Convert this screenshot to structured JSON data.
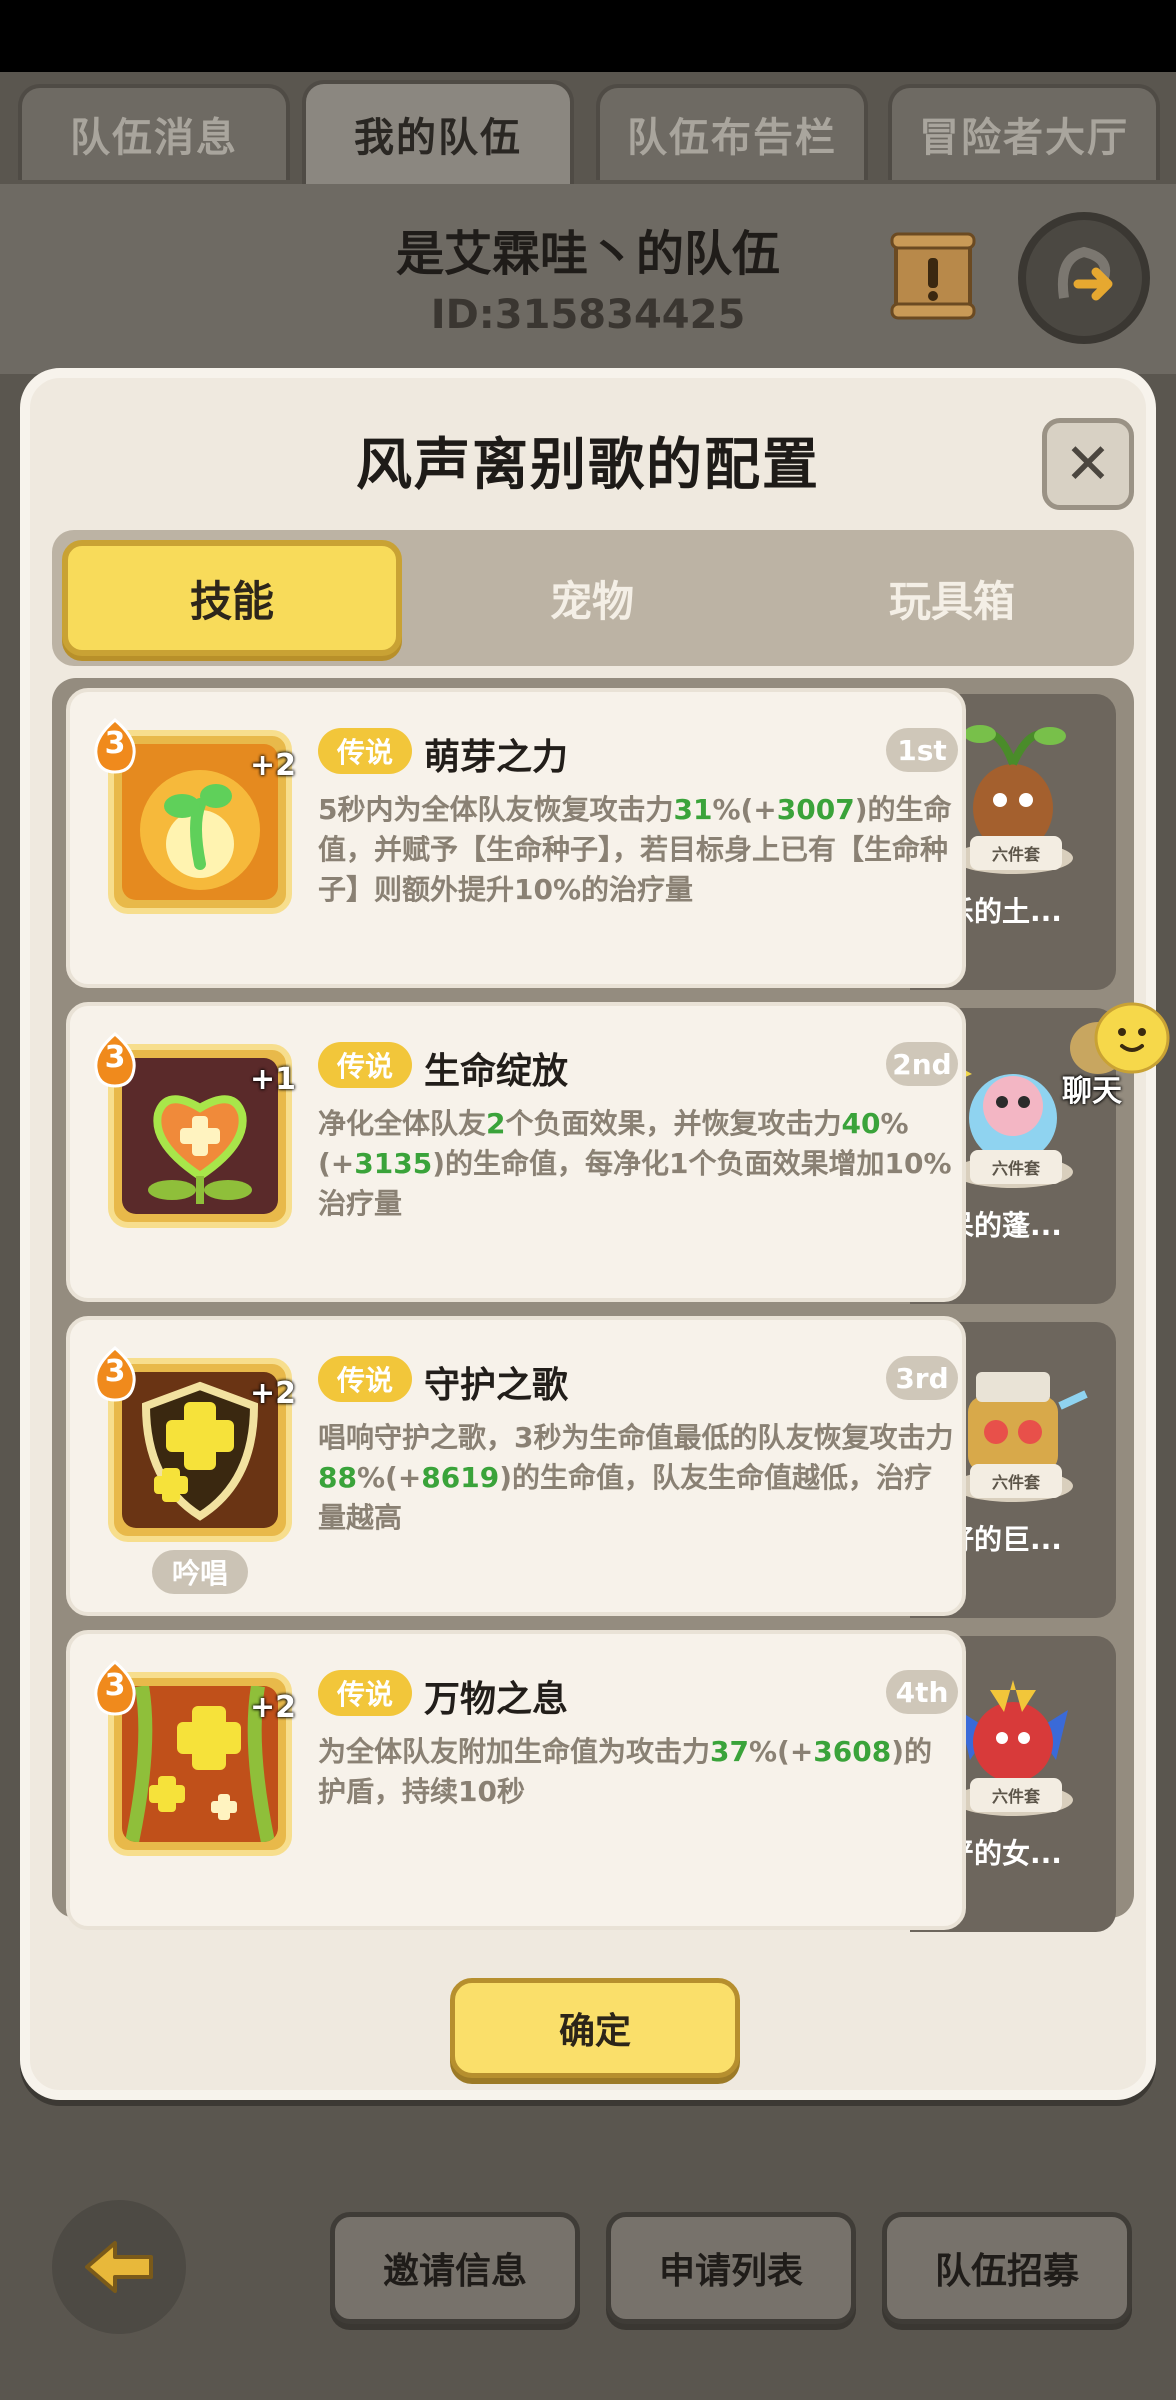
{
  "top_tabs": [
    {
      "label": "队伍消息"
    },
    {
      "label": "我的队伍"
    },
    {
      "label": "队伍布告栏"
    },
    {
      "label": "冒险者大厅"
    }
  ],
  "header": {
    "team_name": "是艾霖哇丶的队伍",
    "team_id": "ID:315834425"
  },
  "modal": {
    "title": "风声离别歌的配置",
    "close_symbol": "✕",
    "tabs": [
      {
        "label": "技能"
      },
      {
        "label": "宠物"
      },
      {
        "label": "玩具箱"
      }
    ],
    "skills": [
      {
        "level": "3",
        "plus": "+2",
        "rarity": "传说",
        "name": "萌芽之力",
        "rank": "1st",
        "desc": [
          "5秒内为全体队友恢复攻击力",
          "31",
          "%(+",
          "3007",
          ")的生命值，并赋予【生命种子】，若目标身上已有【生命种子】则额外提升10%的治疗量"
        ],
        "icon": "sprout-icon"
      },
      {
        "level": "3",
        "plus": "+1",
        "rarity": "传说",
        "name": "生命绽放",
        "rank": "2nd",
        "desc": [
          "净化全体队友",
          "2",
          "个负面效果，并恢复攻击力",
          "40",
          "%(+",
          "3135",
          ")的生命值，每净化1个负面效果增加10%治疗量"
        ],
        "icon": "heart-flower-icon"
      },
      {
        "level": "3",
        "plus": "+2",
        "rarity": "传说",
        "name": "守护之歌",
        "rank": "3rd",
        "desc": [
          "唱响守护之歌，3秒为生命值最低的队友恢复攻击力",
          "88",
          "%(+",
          "8619",
          ")的生命值，队友生命值越低，治疗量越高"
        ],
        "chant": "吟唱",
        "icon": "shield-cross-icon"
      },
      {
        "level": "3",
        "plus": "+2",
        "rarity": "传说",
        "name": "万物之息",
        "rank": "4th",
        "desc": [
          "为全体队友附加生命值为攻击力",
          "37",
          "%(+",
          "3608",
          ")的护盾，持续10秒"
        ],
        "icon": "crosses-flame-icon"
      }
    ],
    "pets": [
      {
        "name": "快乐的土...",
        "set": "六件套"
      },
      {
        "name": "发呆的蓬...",
        "set": "六件套"
      },
      {
        "name": "友好的巨...",
        "set": "六件套"
      },
      {
        "name": "威严的女...",
        "set": "六件套"
      }
    ],
    "confirm_label": "确定"
  },
  "chat": {
    "label": "聊天"
  },
  "bottom": {
    "invite": "邀请信息",
    "applications": "申请列表",
    "recruit": "队伍招募"
  },
  "colors": {
    "accent_yellow": "#f8db5a",
    "highlight_green": "#3aa33a",
    "rarity_gold": "#f2c63a"
  }
}
